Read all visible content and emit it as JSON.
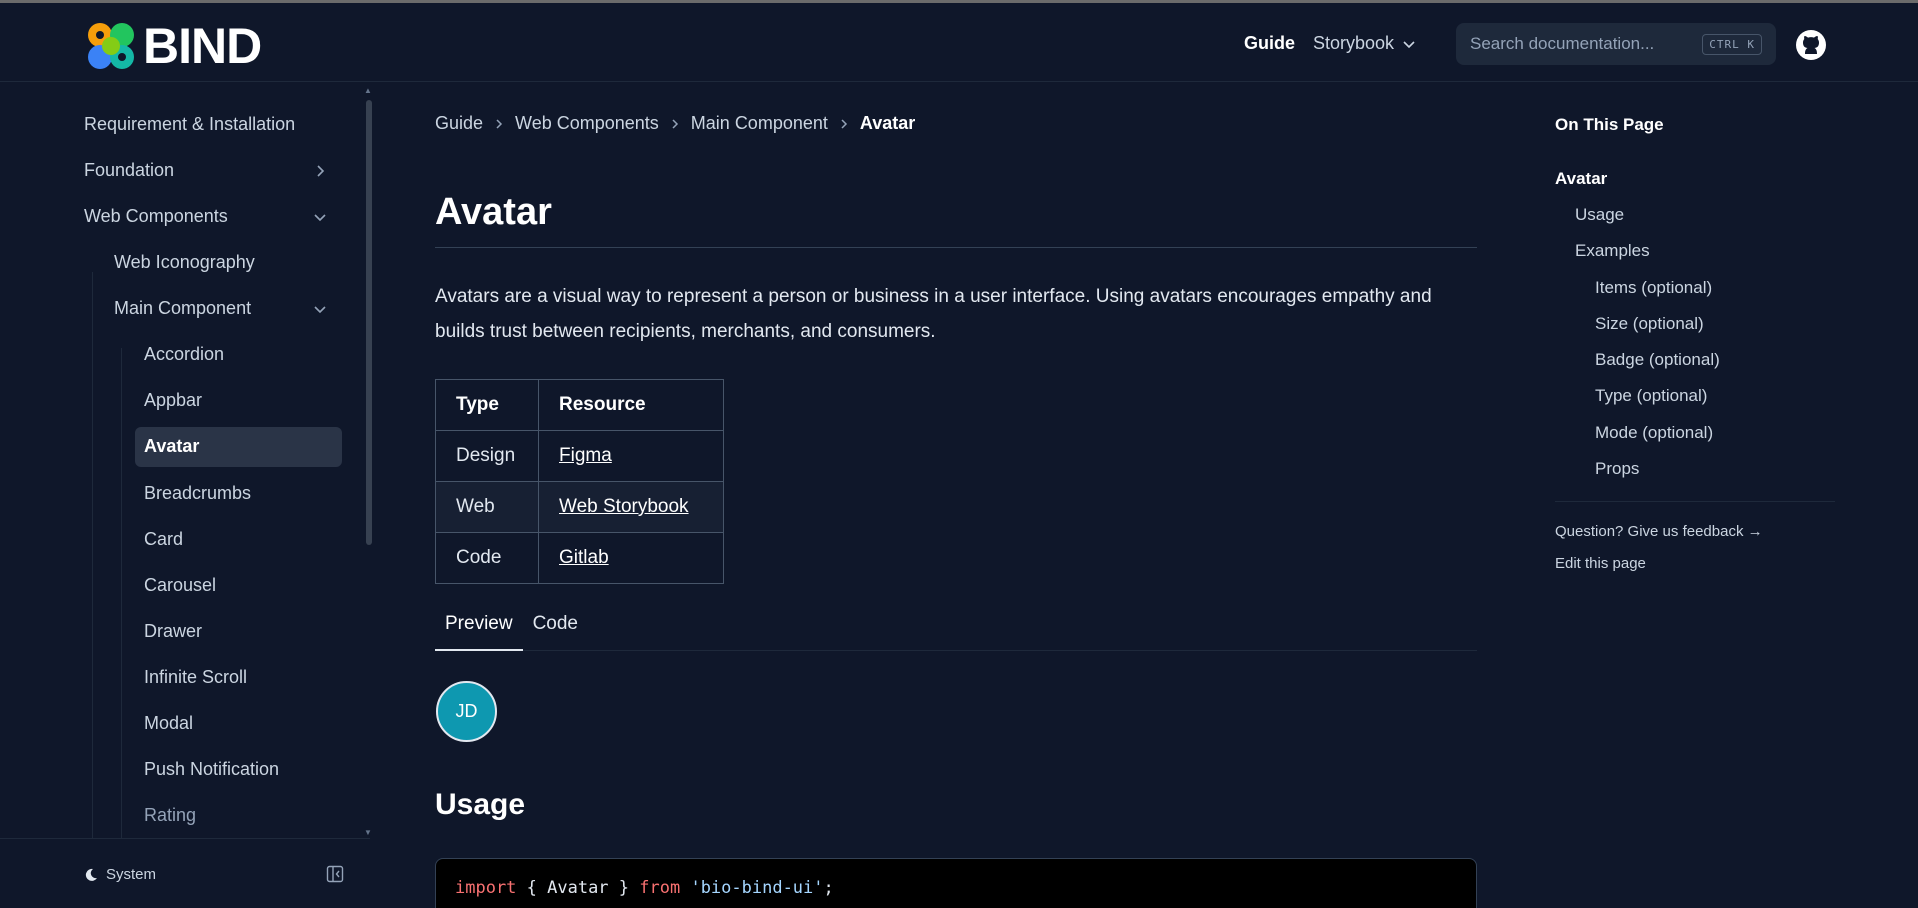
{
  "header": {
    "logo_text": "BIND",
    "nav": {
      "guide": "Guide",
      "storybook": "Storybook"
    },
    "search": {
      "placeholder": "Search documentation...",
      "shortcut": "CTRL K"
    }
  },
  "sidebar": {
    "items": [
      {
        "label": "Requirement & Installation"
      },
      {
        "label": "Foundation"
      },
      {
        "label": "Web Components"
      },
      {
        "label": "Web Iconography"
      },
      {
        "label": "Main Component"
      },
      {
        "label": "Accordion"
      },
      {
        "label": "Appbar"
      },
      {
        "label": "Avatar"
      },
      {
        "label": "Breadcrumbs"
      },
      {
        "label": "Card"
      },
      {
        "label": "Carousel"
      },
      {
        "label": "Drawer"
      },
      {
        "label": "Infinite Scroll"
      },
      {
        "label": "Modal"
      },
      {
        "label": "Push Notification"
      },
      {
        "label": "Rating"
      }
    ],
    "footer": {
      "theme_label": "System"
    }
  },
  "main": {
    "breadcrumb": [
      "Guide",
      "Web Components",
      "Main Component",
      "Avatar"
    ],
    "title": "Avatar",
    "intro": "Avatars are a visual way to represent a person or business in a user interface. Using avatars encourages empathy and builds trust between recipients, merchants, and consumers.",
    "table": {
      "headers": [
        "Type",
        "Resource"
      ],
      "rows": [
        [
          "Design",
          "Figma"
        ],
        [
          "Web",
          "Web Storybook"
        ],
        [
          "Code",
          "Gitlab"
        ]
      ]
    },
    "tabs": [
      "Preview",
      "Code"
    ],
    "avatar_initials": "JD",
    "usage_heading": "Usage",
    "code": {
      "kw1": "import",
      "mid": " { Avatar } ",
      "kw2": "from",
      "str": "'bio-bind-ui'",
      "end": ";"
    }
  },
  "toc": {
    "title": "On This Page",
    "items": [
      "Avatar",
      "Usage",
      "Examples",
      "Items (optional)",
      "Size (optional)",
      "Badge (optional)",
      "Type (optional)",
      "Mode (optional)",
      "Props"
    ],
    "feedback": "Question? Give us feedback →",
    "edit": "Edit this page"
  },
  "colors": {
    "background": "#0f172a",
    "avatar": "#0e98b0",
    "active_item": "#2a3447"
  }
}
